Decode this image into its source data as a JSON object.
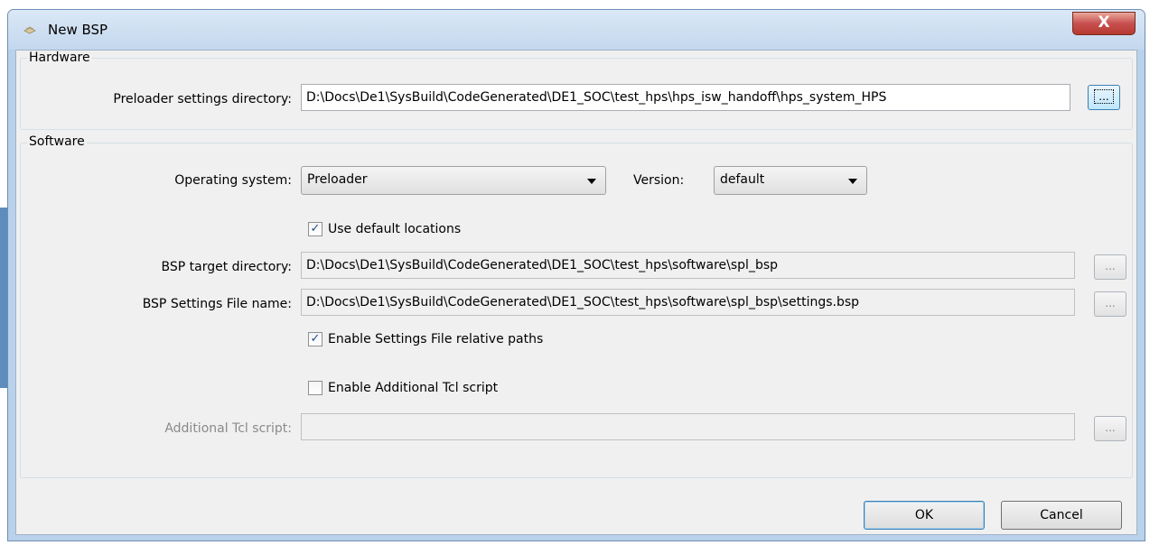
{
  "window": {
    "title": "New BSP",
    "close_label": "X"
  },
  "hardware": {
    "group_label": "Hardware",
    "preloader_label": "Preloader settings directory:",
    "preloader_value": "D:\\Docs\\De1\\SysBuild\\CodeGenerated\\DE1_SOC\\test_hps\\hps_isw_handoff\\hps_system_HPS",
    "browse_label": "..."
  },
  "software": {
    "group_label": "Software",
    "os_label": "Operating system:",
    "os_value": "Preloader",
    "version_label": "Version:",
    "version_value": "default",
    "use_default_locations": {
      "label": "Use default locations",
      "checked": true
    },
    "bsp_target_label": "BSP target directory:",
    "bsp_target_value": "D:\\Docs\\De1\\SysBuild\\CodeGenerated\\DE1_SOC\\test_hps\\software\\spl_bsp",
    "bsp_settings_label": "BSP Settings File name:",
    "bsp_settings_value": "D:\\Docs\\De1\\SysBuild\\CodeGenerated\\DE1_SOC\\test_hps\\software\\spl_bsp\\settings.bsp",
    "relative_paths": {
      "label": "Enable Settings File relative paths",
      "checked": true
    },
    "additional_tcl": {
      "label": "Enable Additional Tcl script",
      "checked": false
    },
    "additional_tcl_label": "Additional Tcl script:",
    "additional_tcl_value": "",
    "browse_label": "..."
  },
  "buttons": {
    "ok": "OK",
    "cancel": "Cancel"
  },
  "colors": {
    "client_bg": "#f0f0f0",
    "titlebar": "#c3d7ee",
    "close": "#c75050"
  }
}
